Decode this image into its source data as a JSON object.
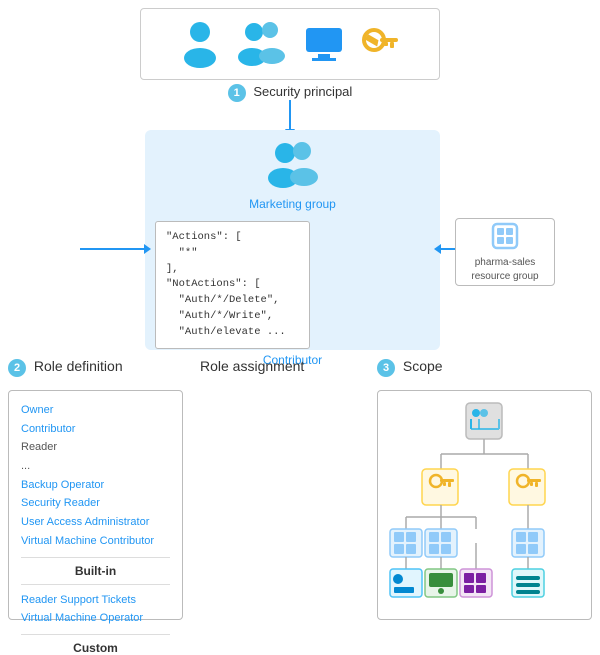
{
  "security_principal": {
    "label": "Security principal",
    "number": "1"
  },
  "role_definition": {
    "section_number": "2",
    "section_label": "Role definition",
    "items_builtin": [
      "Owner",
      "Contributor",
      "Reader",
      "...",
      "Backup Operator",
      "Security Reader",
      "User Access Administrator",
      "Virtual Machine Contributor"
    ],
    "items_custom": [
      "Reader Support Tickets",
      "Virtual Machine Operator"
    ],
    "builtin_label": "Built-in",
    "custom_label": "Custom"
  },
  "role_assignment": {
    "label": "Role assignment",
    "group_name": "Marketing group",
    "code": "\"Actions\": [\n  \"*\"\n],\n\"NotActions\": [\n  \"Auth/*/Delete\",\n  \"Auth/*/Write\",\n  \"Auth/elevate ...",
    "role_label": "Contributor"
  },
  "scope": {
    "section_number": "3",
    "section_label": "Scope"
  },
  "pharma": {
    "name": "pharma-sales",
    "sub": "resource group"
  }
}
